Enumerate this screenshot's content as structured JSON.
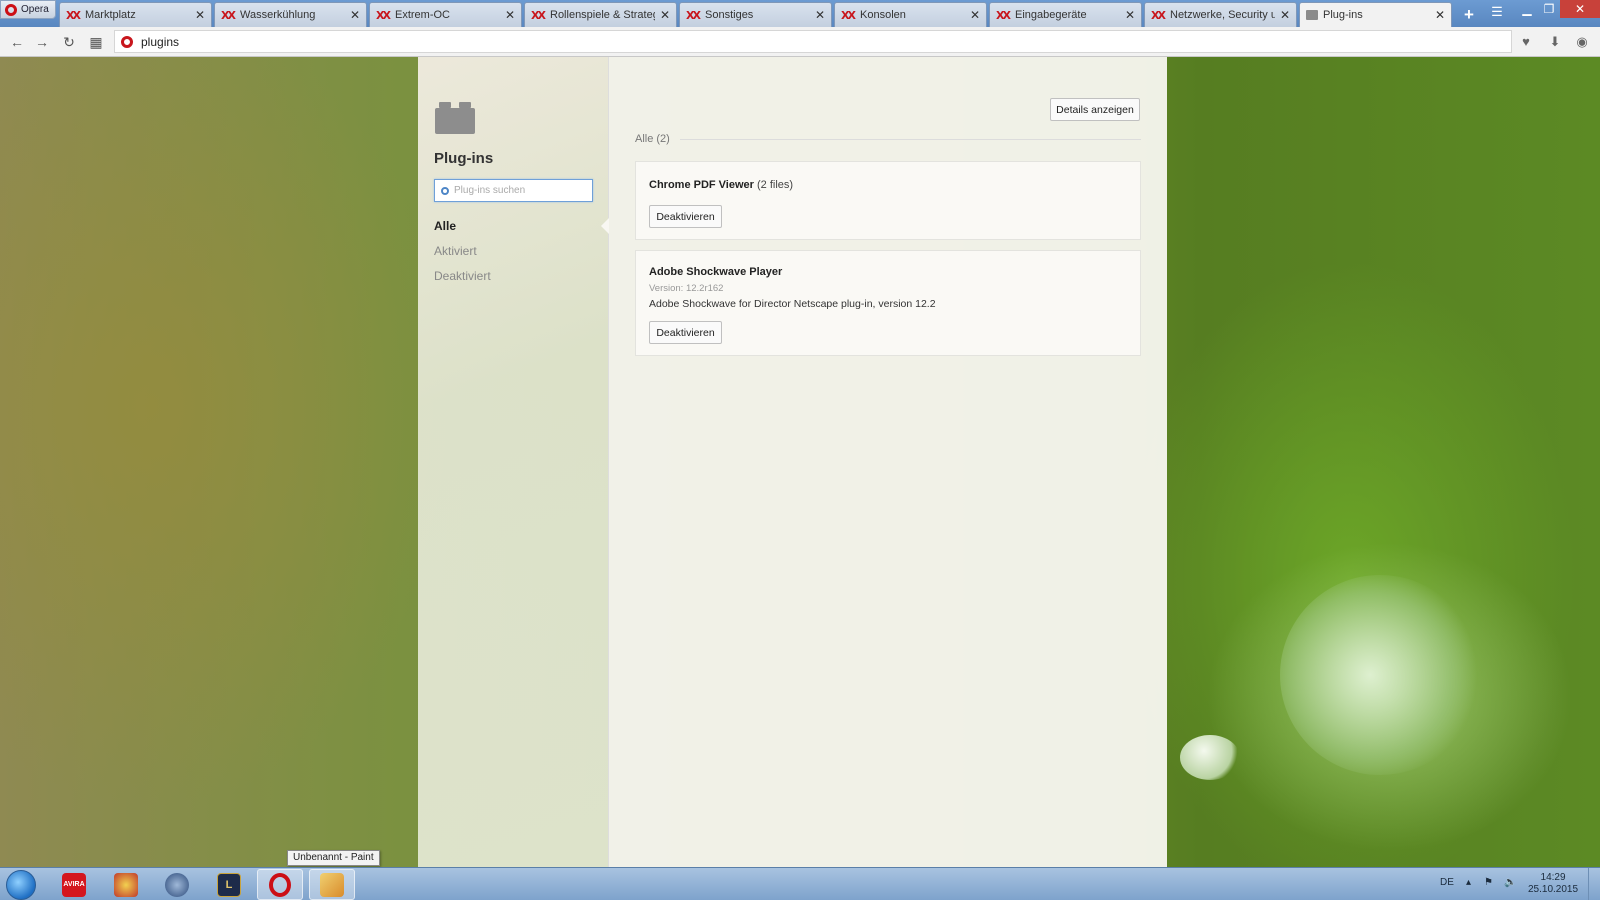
{
  "browser": {
    "menu_label": "Opera",
    "tabs": [
      {
        "label": "Marktplatz",
        "icon": "xtreme-favicon"
      },
      {
        "label": "Wasserkühlung",
        "icon": "xtreme-favicon"
      },
      {
        "label": "Extrem-OC",
        "icon": "xtreme-favicon"
      },
      {
        "label": "Rollenspiele & Strategie",
        "icon": "xtreme-favicon"
      },
      {
        "label": "Sonstiges",
        "icon": "xtreme-favicon"
      },
      {
        "label": "Konsolen",
        "icon": "xtreme-favicon"
      },
      {
        "label": "Eingabegeräte",
        "icon": "xtreme-favicon"
      },
      {
        "label": "Netzwerke, Security und",
        "icon": "xtreme-favicon"
      },
      {
        "label": "Plug-ins",
        "icon": "puzzle-icon",
        "active": true
      }
    ],
    "address": "plugins",
    "favicon_glyph": "XX",
    "accent_color": "#c8161d"
  },
  "sidebar": {
    "title": "Plug-ins",
    "search_placeholder": "Plug-ins suchen",
    "nav": [
      {
        "label": "Alle",
        "selected": true
      },
      {
        "label": "Aktiviert",
        "selected": false
      },
      {
        "label": "Deaktiviert",
        "selected": false
      }
    ]
  },
  "main": {
    "details_button": "Details anzeigen",
    "section_label": "Alle (2)",
    "plugins": [
      {
        "name": "Chrome PDF Viewer",
        "files": "(2 files)",
        "button": "Deaktivieren"
      },
      {
        "name": "Adobe Shockwave Player",
        "version": "Version: 12.2r162",
        "description": "Adobe Shockwave for Director Netscape plug-in, version 12.2",
        "button": "Deaktivieren"
      }
    ]
  },
  "taskbar": {
    "tooltip": "Unbenannt - Paint",
    "apps": [
      {
        "name": "avira",
        "label": "AVIRA",
        "color": "#d4161e"
      },
      {
        "name": "ccleaner",
        "label": "",
        "color": "#c0392b"
      },
      {
        "name": "teamspeak",
        "label": "",
        "color": "#2b4a7a"
      },
      {
        "name": "league-of-legends",
        "label": "L",
        "color": "#1d2b4a"
      },
      {
        "name": "opera",
        "label": "O",
        "color": "#cc0f16"
      },
      {
        "name": "paint",
        "label": "",
        "color": "#e8b230"
      }
    ],
    "language": "DE",
    "time": "14:29",
    "date": "25.10.2015"
  }
}
